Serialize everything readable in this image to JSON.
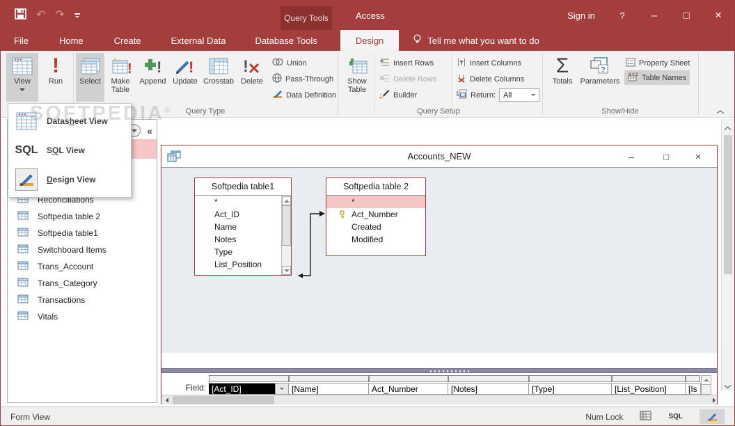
{
  "colors": {
    "titlebar_red": "#A33E3C",
    "contextual_tab_red": "#8C3130",
    "active_tab_text": "#A6403E",
    "ribbon_bg": "#F2F2F2",
    "pressed_gray": "#D0D0D0",
    "window_border_red": "#A13C3A",
    "selection_pink": "#F6C6C6",
    "diagram_bg": "#E9EDF1",
    "splitter_purple": "#8B89A6"
  },
  "titlebar": {
    "contextual_tab": "Query Tools",
    "app_title": "Access",
    "sign_in": "Sign in",
    "help_glyph": "?",
    "minimize_glyph": "–",
    "maximize_glyph": "□",
    "close_glyph": "×",
    "undo_glyph": "↶",
    "redo_glyph": "↷"
  },
  "tabs": {
    "file": "File",
    "home": "Home",
    "create": "Create",
    "external_data": "External Data",
    "database_tools": "Database Tools",
    "design": "Design",
    "tell_me": "Tell me what you want to do"
  },
  "ribbon": {
    "results": {
      "view": "View",
      "run": "Run"
    },
    "query_type": {
      "label": "Query Type",
      "select": "Select",
      "make_table_1": "Make",
      "make_table_2": "Table",
      "append": "Append",
      "update": "Update",
      "crosstab": "Crosstab",
      "delete": "Delete",
      "union": "Union",
      "pass_through": "Pass-Through",
      "data_definition": "Data Definition"
    },
    "query_setup": {
      "label": "Query Setup",
      "show_table_1": "Show",
      "show_table_2": "Table",
      "insert_rows": "Insert Rows",
      "delete_rows": "Delete Rows",
      "builder": "Builder",
      "insert_columns": "Insert Columns",
      "delete_columns": "Delete Columns",
      "return_label": "Return:",
      "return_value": "All"
    },
    "show_hide": {
      "label": "Show/Hide",
      "totals": "Totals",
      "totals_glyph": "Σ",
      "parameters": "Parameters",
      "property_sheet": "Property Sheet",
      "table_names": "Table Names"
    }
  },
  "view_menu": {
    "sql_icon_text": "SQL",
    "items": [
      {
        "pre": "Datas",
        "mn": "h",
        "post": "eet View"
      },
      {
        "pre": "S",
        "mn": "Q",
        "post": "L View"
      },
      {
        "pre": "",
        "mn": "D",
        "post": "esign View"
      }
    ]
  },
  "nav_pane": {
    "collapse_glyph": "«",
    "items": [
      "Reconciliations",
      "Softpedia table 2",
      "Softpedia table1",
      "Switchboard Items",
      "Trans_Account",
      "Trans_Category",
      "Transactions",
      "Vitals"
    ]
  },
  "query_window": {
    "title": "Accounts_NEW",
    "minimize_glyph": "–",
    "maximize_glyph": "□",
    "close_glyph": "×",
    "table1": {
      "name": "Softpedia table1",
      "fields": [
        "*",
        "Act_ID",
        "Name",
        "Notes",
        "Type",
        "List_Position"
      ]
    },
    "table2": {
      "name": "Softpedia table 2",
      "fields": [
        "*",
        "Act_Number",
        "Created",
        "Modified"
      ]
    },
    "grid": {
      "row_label": "Field:",
      "cells": [
        "[Act_ID]",
        "[Name]",
        "Act_Number",
        "[Notes]",
        "[Type]",
        "[List_Position]",
        "[Is"
      ]
    }
  },
  "status_bar": {
    "view_state": "Form View",
    "num_lock": "Num Lock",
    "sql_label": "SQL"
  },
  "watermark": "SOFTPEDIA"
}
